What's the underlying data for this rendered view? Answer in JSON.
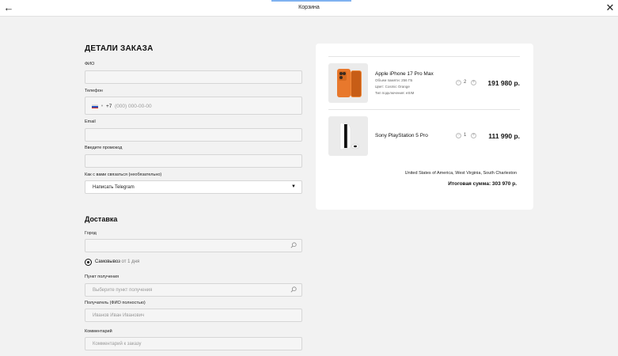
{
  "header": {
    "title": "Корзина",
    "back_icon": "arrow-left-icon",
    "close_icon": "close-icon"
  },
  "form": {
    "heading": "ДЕТАЛИ ЗАКАЗА",
    "fio_label": "ФИО",
    "phone_label": "Телефон",
    "phone_code": "+7",
    "phone_placeholder": "(000) 000-00-00",
    "email_label": "Email",
    "promo_label": "Введите промокод",
    "contact_label": "Как с вами связаться (необязательно)",
    "contact_value": "Написать Telegram",
    "delivery_heading": "Доставка",
    "city_label": "Город",
    "pickup_label": "Самовывоз",
    "pickup_suffix": "от 1 дня",
    "point_label": "Пункт получения",
    "point_placeholder": "Выберите пункт получения",
    "recipient_label": "Получатель (ФИО полностью)",
    "recipient_placeholder": "Иванов Иван Иванович",
    "comment_label": "Комментарий",
    "comment_placeholder": "Комментарий к заказу"
  },
  "cart": {
    "items": [
      {
        "name": "Apple iPhone 17 Pro Max",
        "attrs": [
          "Объем памяти: 256 ГБ",
          "Цвет: Cosmic Orange",
          "Тип подключения: eSIM"
        ],
        "qty": "2",
        "price": "191 980 р."
      },
      {
        "name": "Sony PlayStation 5 Pro",
        "attrs": [],
        "qty": "1",
        "price": "111 990 р."
      }
    ],
    "address": "United States of America, West Virginia, South Charleston",
    "total": "Итоговая сумма: 303 970 р."
  },
  "colors": {
    "accent": "#7fb2f0",
    "iphone_orange": "#e8782c"
  }
}
